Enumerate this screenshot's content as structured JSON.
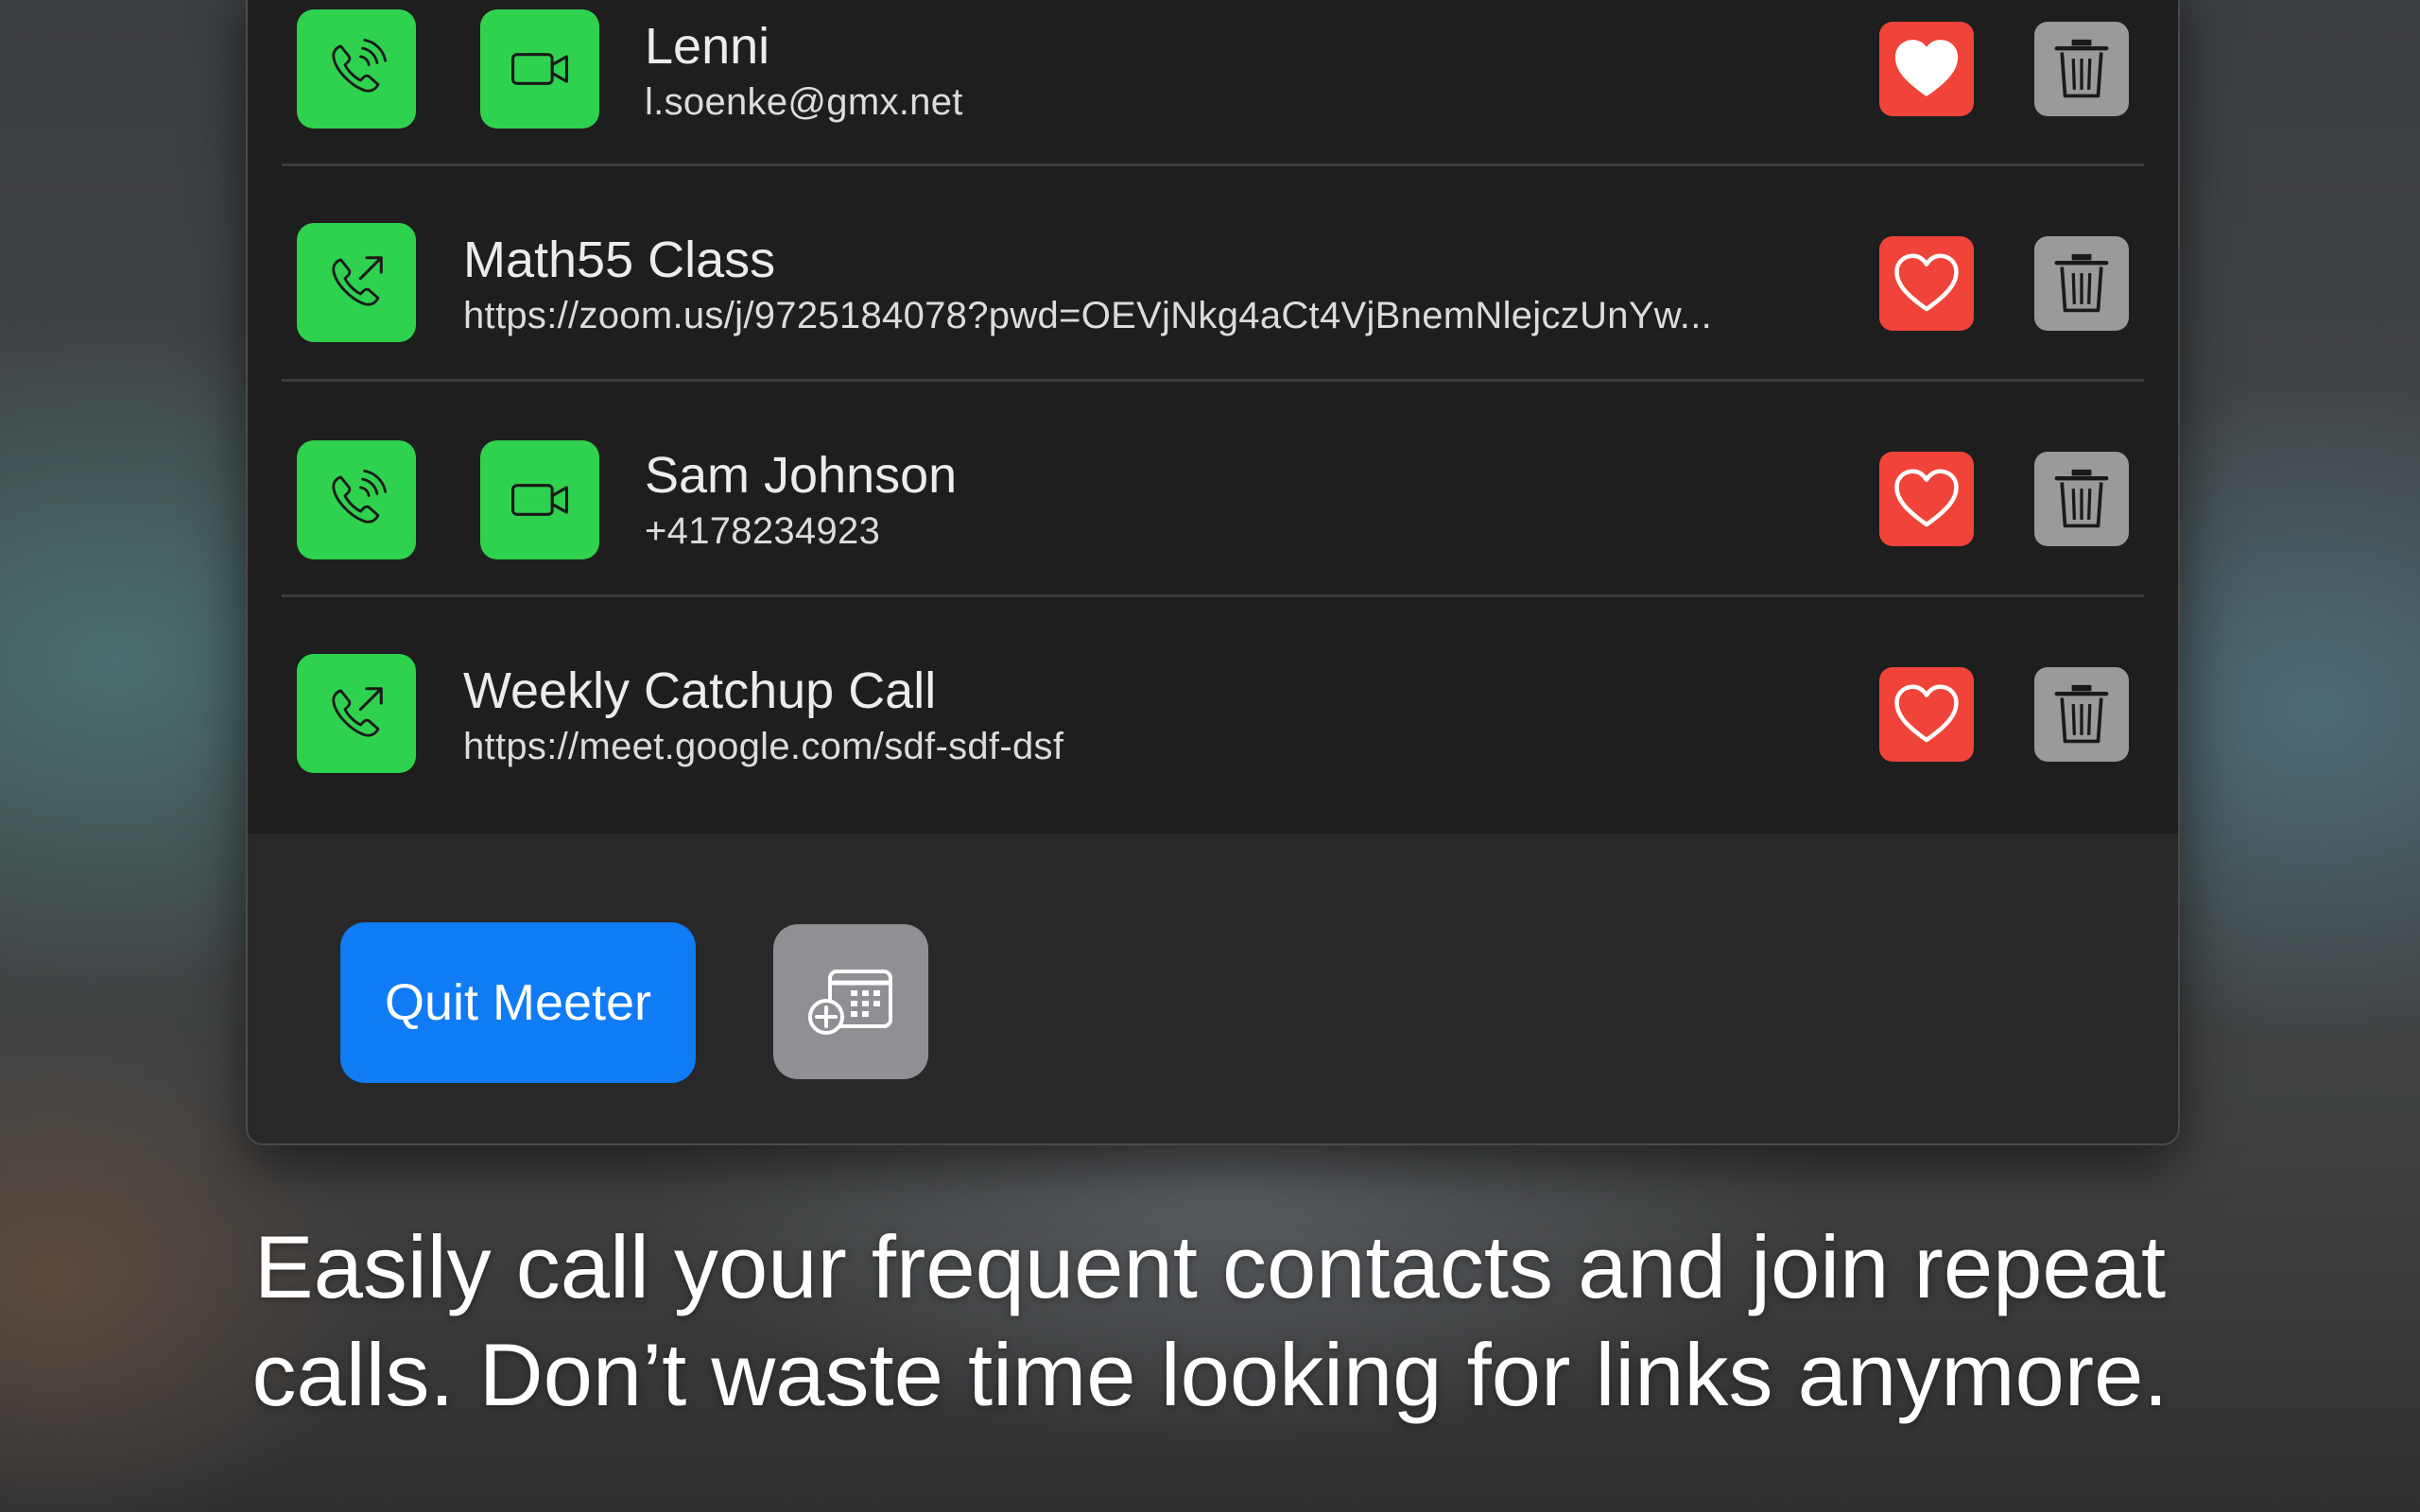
{
  "contacts": [
    {
      "name": "Lenni",
      "detail": "l.soenke@gmx.net",
      "actions": [
        "phone-call",
        "video-call"
      ],
      "favorite": true
    },
    {
      "name": "Math55 Class",
      "detail": "https://zoom.us/j/9725184078?pwd=OEVjNkg4aCt4VjBnemNlejczUnYw...",
      "actions": [
        "join-link"
      ],
      "favorite": false
    },
    {
      "name": "Sam Johnson",
      "detail": "+4178234923",
      "actions": [
        "phone-call",
        "video-call"
      ],
      "favorite": false
    },
    {
      "name": "Weekly Catchup Call",
      "detail": "https://meet.google.com/sdf-sdf-dsf",
      "actions": [
        "join-link"
      ],
      "favorite": false
    }
  ],
  "footer": {
    "quit_label": "Quit Meeter",
    "calendar_icon": "calendar-add-icon"
  },
  "caption": {
    "line1": "Easily call your frequent contacts and join repeat",
    "line2": "calls. Don’t waste time looking for links anymore."
  },
  "colors": {
    "call_green": "#2fd24f",
    "heart_red": "#f0433a",
    "trash_gray": "#9a9a9a",
    "quit_blue": "#0f7bf5",
    "calendar_gray": "#8f8f94"
  }
}
